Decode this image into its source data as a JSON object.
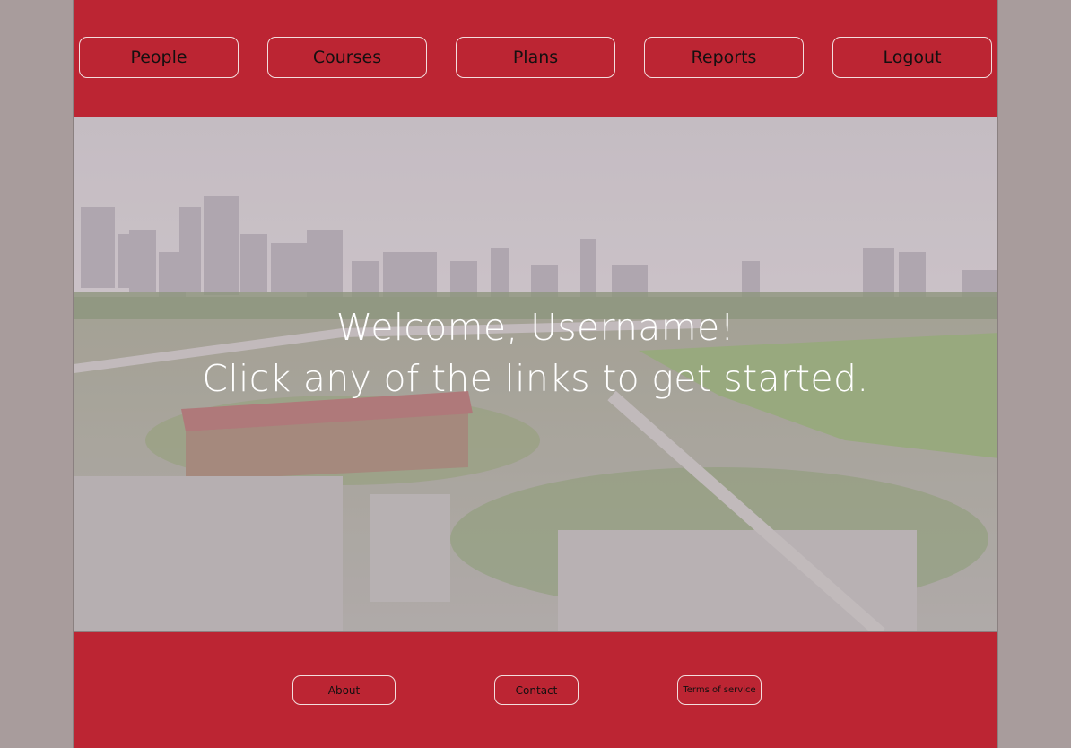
{
  "nav": {
    "items": [
      {
        "label": "People"
      },
      {
        "label": "Courses"
      },
      {
        "label": "Plans"
      },
      {
        "label": "Reports"
      },
      {
        "label": "Logout"
      }
    ]
  },
  "hero": {
    "line1": "Welcome, Username!",
    "line2": "Click any of the links to get started."
  },
  "footer": {
    "about": "About",
    "contact": "Contact",
    "terms": "Terms of service"
  },
  "colors": {
    "brand_red": "#bc2533",
    "page_background": "#a89c9c",
    "button_border": "#f3dede"
  }
}
